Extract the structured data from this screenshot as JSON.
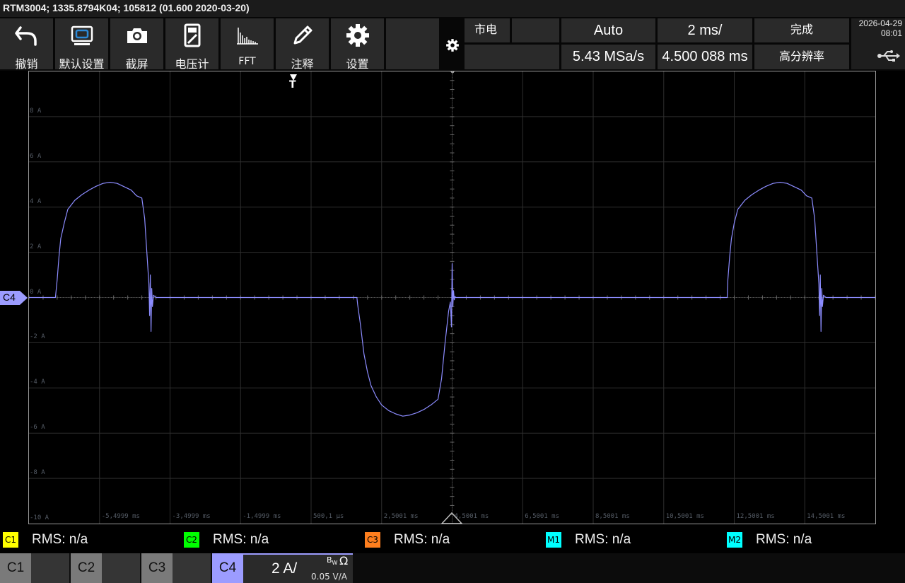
{
  "title_bar": "RTM3004; 1335.8794K04; 105812 (01.600 2020-03-20)",
  "toolbar": {
    "buttons": [
      {
        "label": "撤销",
        "icon": "undo-icon"
      },
      {
        "label": "默认设置",
        "icon": "preset-icon"
      },
      {
        "label": "截屏",
        "icon": "camera-icon"
      },
      {
        "label": "电压计",
        "icon": "voltmeter-icon"
      },
      {
        "label": "FFT",
        "icon": "fft-icon"
      },
      {
        "label": "注释",
        "icon": "pencil-icon"
      },
      {
        "label": "设置",
        "icon": "gear-icon"
      }
    ]
  },
  "acquisition": {
    "power": "市电",
    "trigger_mode": "Auto",
    "timebase": "2 ms/",
    "status": "完成",
    "sample_rate": "5.43 MSa/s",
    "position": "4.500 088 ms",
    "acq_mode": "高分辨率"
  },
  "clock": {
    "date": "2026-04-29",
    "time": "08:01"
  },
  "markers": {
    "channel": "C4",
    "trigger": "T"
  },
  "chart_data": {
    "type": "line",
    "title": "",
    "xlabel": "",
    "ylabel": "",
    "xlim": [
      -7.4999,
      16.5001
    ],
    "ylim": [
      -10,
      10
    ],
    "grid": true,
    "y_ticks": [
      "8 A",
      "6 A",
      "4 A",
      "2 A",
      "0 A",
      "-2 A",
      "-4 A",
      "-6 A",
      "-8 A",
      "-10 A"
    ],
    "y_tick_values": [
      8,
      6,
      4,
      2,
      0,
      -2,
      -4,
      -6,
      -8,
      -10
    ],
    "x_ticks": [
      "-5,4999 ms",
      "-3,4999 ms",
      "-1,4999 ms",
      "500,1 µs",
      "2,5001 ms",
      "4,5001 ms",
      "6,5001 ms",
      "8,5001 ms",
      "10,5001 ms",
      "12,5001 ms",
      "14,5001 ms"
    ],
    "x_tick_values": [
      -5.4999,
      -3.4999,
      -1.4999,
      0.5001,
      2.5001,
      4.5001,
      6.5001,
      8.5001,
      10.5001,
      12.5001,
      14.5001
    ],
    "series": [
      {
        "color": "#8c8cff",
        "x": [
          -7.5,
          -6.75,
          -6.7,
          -6.65,
          -6.6,
          -6.5,
          -6.4,
          -6.2,
          -6.0,
          -5.8,
          -5.6,
          -5.4,
          -5.2,
          -5.0,
          -4.8,
          -4.6,
          -4.45,
          -4.3,
          -4.22,
          -4.15,
          -4.1,
          -4.08,
          -4.06,
          -4.04,
          -4.02,
          -4.0,
          -3.97,
          -3.9,
          -3.5,
          0.0,
          1.0,
          1.8,
          1.82,
          1.9,
          2.0,
          2.1,
          2.2,
          2.35,
          2.5,
          2.7,
          2.9,
          3.1,
          3.3,
          3.5,
          3.7,
          3.9,
          4.1,
          4.2,
          4.3,
          4.4,
          4.45,
          4.48,
          4.5,
          4.52,
          4.54,
          4.56,
          4.58,
          4.6,
          4.65,
          5.0,
          8.0,
          12.3,
          12.32,
          12.37,
          12.42,
          12.5,
          12.6,
          12.8,
          13.0,
          13.2,
          13.4,
          13.6,
          13.8,
          14.0,
          14.2,
          14.4,
          14.55,
          14.7,
          14.78,
          14.85,
          14.9,
          14.92,
          14.94,
          14.96,
          14.98,
          15.0,
          15.03,
          15.1,
          15.5,
          16.5
        ],
        "y": [
          0,
          0,
          0.8,
          1.8,
          2.6,
          3.3,
          3.9,
          4.3,
          4.55,
          4.75,
          4.92,
          5.05,
          5.1,
          5.05,
          4.9,
          4.75,
          4.5,
          4.4,
          3.5,
          1.8,
          0.6,
          -0.8,
          1.0,
          -1.5,
          0.4,
          -0.4,
          0.1,
          0,
          0,
          0,
          0,
          0,
          -0.3,
          -1.2,
          -2.5,
          -3.3,
          -3.9,
          -4.4,
          -4.75,
          -5.0,
          -5.15,
          -5.25,
          -5.2,
          -5.1,
          -4.95,
          -4.75,
          -4.5,
          -3.6,
          -2.0,
          -0.6,
          -0.2,
          -1.3,
          1.5,
          -0.4,
          0.3,
          -0.1,
          0.05,
          0,
          0,
          0,
          0,
          0,
          0.8,
          1.8,
          2.6,
          3.3,
          3.9,
          4.3,
          4.55,
          4.75,
          4.92,
          5.05,
          5.1,
          5.05,
          4.9,
          4.75,
          4.5,
          4.4,
          3.5,
          1.8,
          0.6,
          -0.8,
          1.0,
          -1.5,
          0.4,
          -0.4,
          0.1,
          0,
          0,
          0
        ]
      }
    ]
  },
  "measurements": [
    {
      "channel": "C1",
      "color": "#ffff00",
      "text": "RMS: n/a"
    },
    {
      "channel": "C2",
      "color": "#00ff00",
      "text": "RMS: n/a"
    },
    {
      "channel": "C3",
      "color": "#ff7f1e",
      "text": "RMS: n/a"
    },
    {
      "channel": "M1",
      "color": "#00ffff",
      "text": "RMS: n/a"
    },
    {
      "channel": "M2",
      "color": "#00ffff",
      "text": "RMS: n/a"
    }
  ],
  "channels": {
    "c1": "C1",
    "c2": "C2",
    "c3": "C3",
    "c4": "C4",
    "c4_scale": "2 A/",
    "c4_bw": "B",
    "c4_bw_sub": "W",
    "c4_coupling": "Ω",
    "c4_probe": "0.05 V/A"
  },
  "colors": {
    "c4": "#9c9cff",
    "trace": "#8c8cff",
    "grid": "#2e2e2e",
    "frame": "#9a9a9a"
  }
}
